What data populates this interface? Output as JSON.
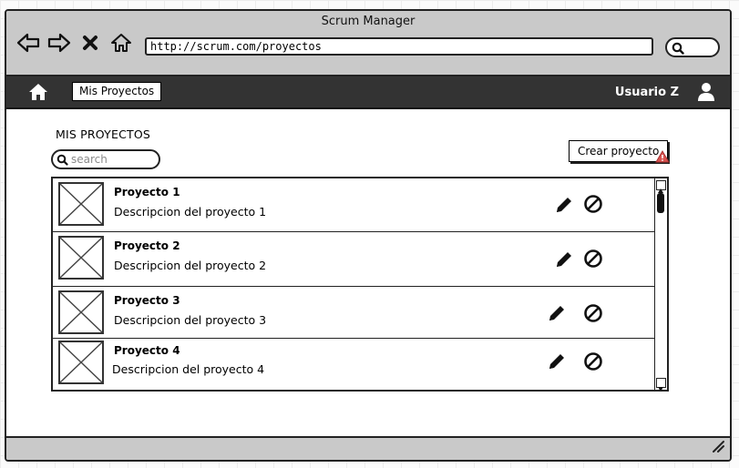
{
  "window": {
    "title": "Scrum Manager"
  },
  "browser": {
    "url": "http://scrum.com/proyectos",
    "icons": [
      "back-arrow-icon",
      "forward-arrow-icon",
      "close-icon",
      "home-outline-icon",
      "search-icon"
    ]
  },
  "navbar": {
    "tab_label": "Mis Proyectos",
    "user_name": "Usuario Z",
    "icons": [
      "home-icon",
      "user-icon"
    ]
  },
  "main": {
    "title": "MIS PROYECTOS",
    "search_placeholder": "search",
    "create_button": "Crear proyecto",
    "projects": [
      {
        "name": "Proyecto 1",
        "description": "Descripcion del proyecto 1"
      },
      {
        "name": "Proyecto 2",
        "description": "Descripcion del proyecto 2"
      },
      {
        "name": "Proyecto 3",
        "description": "Descripcion del proyecto 3"
      },
      {
        "name": "Proyecto 4",
        "description": "Descripcion del proyecto 4"
      }
    ],
    "row_icons": [
      "edit-pencil-icon",
      "block-icon"
    ]
  },
  "colors": {
    "navbar": "#333333",
    "chrome": "#c9c9c9",
    "warning": "#d9534f"
  }
}
